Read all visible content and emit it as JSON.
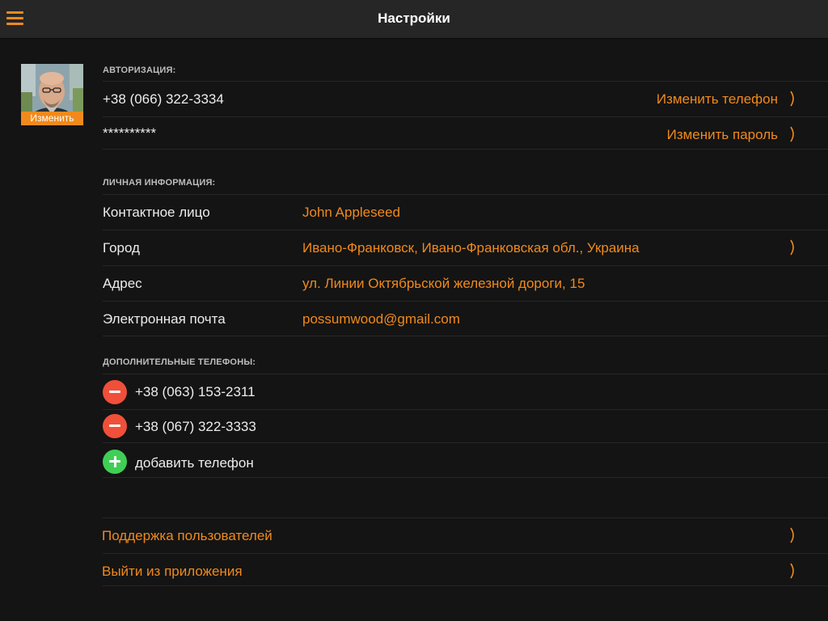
{
  "header": {
    "title": "Настройки",
    "menu_icon": "hamburger-menu-icon",
    "accent_color": "#f08a1c"
  },
  "avatar": {
    "change_label": "Изменить"
  },
  "auth": {
    "section_title": "АВТОРИЗАЦИЯ:",
    "phone": "+38 (066) 322-3334",
    "change_phone_label": "Изменить телефон",
    "password_mask": "**********",
    "change_password_label": "Изменить пароль"
  },
  "personal": {
    "section_title": "ЛИЧНАЯ ИНФОРМАЦИЯ:",
    "rows": [
      {
        "label": "Контактное лицо",
        "value": "John Appleseed"
      },
      {
        "label": "Город",
        "value": "Ивано-Франковск, Ивано-Франковская обл., Украина"
      },
      {
        "label": "Адрес",
        "value": "ул. Линии Октябрьской железной дороги, 15"
      },
      {
        "label": "Электронная почта",
        "value": "possumwood@gmail.com"
      }
    ]
  },
  "extra_phones": {
    "section_title": "ДОПОЛНИТЕЛЬНЫЕ ТЕЛЕФОНЫ:",
    "phones": [
      "+38 (063) 153-2311",
      "+38 (067) 322-3333"
    ],
    "add_label": "добавить телефон",
    "remove_color": "#f04f3a",
    "add_color": "#3fcf55"
  },
  "footer_links": {
    "support": "Поддержка пользователей",
    "logout": "Выйти из приложения"
  }
}
